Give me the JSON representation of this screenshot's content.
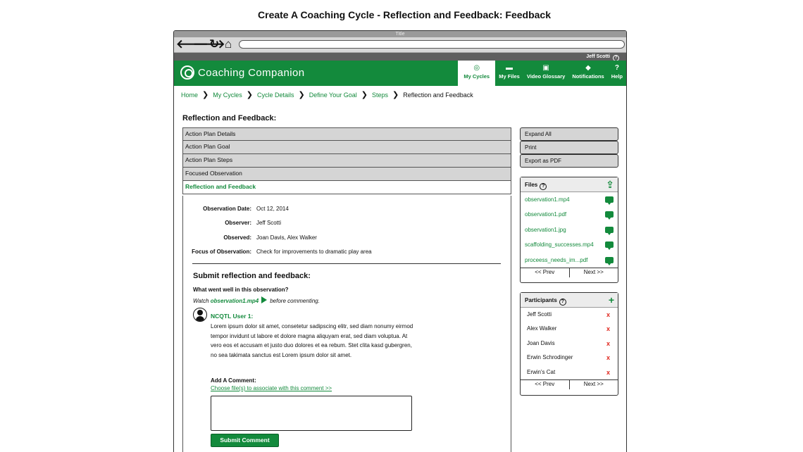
{
  "page_heading": "Create A Coaching Cycle - Reflection and Feedback: Feedback",
  "browser": {
    "title": "Title",
    "nav": {
      "back": "🡐",
      "forward": "🡒",
      "reload": "↻",
      "home": "⌂"
    }
  },
  "userbar": {
    "user": "Jeff Scotti",
    "help": "?"
  },
  "app": {
    "brand": "Coaching Companion",
    "nav": [
      {
        "label": "My Cycles",
        "icon": "cycles-icon",
        "glyph": "◎",
        "active": true
      },
      {
        "label": "My Files",
        "icon": "folder-icon",
        "glyph": "▬"
      },
      {
        "label": "Video Glossary",
        "icon": "video-icon",
        "glyph": "▣"
      },
      {
        "label": "Notifications",
        "icon": "bell-icon",
        "glyph": "◆"
      },
      {
        "label": "Help",
        "icon": "help-icon",
        "glyph": "?"
      }
    ]
  },
  "breadcrumb": {
    "links": [
      "Home",
      "My Cycles",
      "Cycle Details",
      "Define Your Goal",
      "Steps"
    ],
    "current": "Reflection and Feedback",
    "sep": "❯"
  },
  "section_title": "Reflection and Feedback:",
  "accordion": [
    "Action Plan Details",
    "Action Plan Goal",
    "Action Plan Steps",
    "Focused Observation",
    "Reflection and Feedback"
  ],
  "details": [
    {
      "label": "Observation Date:",
      "value": "Oct 12, 2014"
    },
    {
      "label": "Observer:",
      "value": "Jeff Scotti"
    },
    {
      "label": "Observed:",
      "value": "Joan Davis, Alex Walker"
    },
    {
      "label": "Focus of Observation:",
      "value": "Check for improvements to dramatic play area"
    }
  ],
  "submit": {
    "title": "Submit reflection and feedback:",
    "question": "What went well in this observation?",
    "watch_prefix": "Watch",
    "watch_file": "observation1.mp4",
    "watch_suffix": "before commenting.",
    "commenter": "NCQTL User 1:",
    "comment": "Lorem ipsum dolor sit amet, consetetur sadipscing elitr, sed diam nonumy eirmod tempor invidunt ut labore et dolore magna aliquyam erat, sed diam voluptua. At vero eos et accusam et justo duo dolores et ea rebum. Stet clita kasd gubergren, no sea takimata sanctus est Lorem ipsum dolor sit amet.",
    "add_comment": "Add A Comment:",
    "choose_file": "Choose file(s) to associate with this comment >>",
    "comment_value": "",
    "button": "Submit Comment"
  },
  "side_buttons": [
    "Expand All",
    "Print",
    "Export as PDF"
  ],
  "files": {
    "title": "Files",
    "help": "?",
    "upload_glyph": "⇪",
    "items": [
      "observation1.mp4",
      "observation1.pdf",
      "observation1.jpg",
      "scaffolding_successes.mp4",
      "proceess_needs_im...pdf"
    ],
    "prev": "<< Prev",
    "next": "Next >>"
  },
  "participants": {
    "title": "Participants",
    "help": "?",
    "add_glyph": "+",
    "items": [
      "Jeff Scotti",
      "Alex Walker",
      "Joan Davis",
      "Erwin Schrodinger",
      "Erwin's Cat"
    ],
    "remove": "x",
    "prev": "<< Prev",
    "next": "Next >>"
  },
  "colors": {
    "brand": "#138a3c",
    "danger": "#e0241b",
    "tab_bg": "#d5d5d5"
  }
}
